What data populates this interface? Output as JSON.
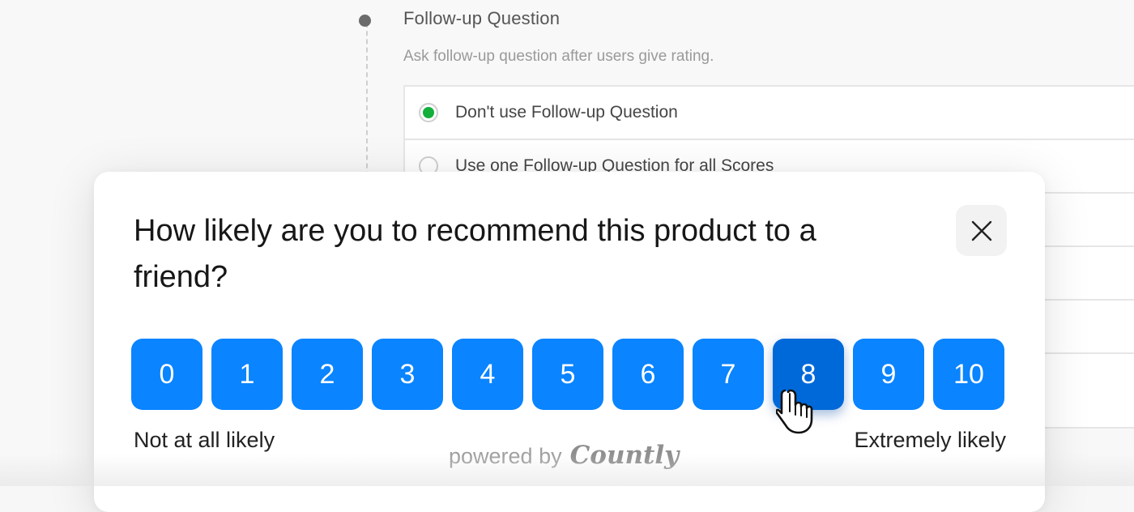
{
  "settings": {
    "section_title": "Follow-up Question",
    "section_description": "Ask follow-up question after users give rating.",
    "options": [
      {
        "label": "Don't use Follow-up Question",
        "checked": true
      },
      {
        "label": "Use one Follow-up Question for all Scores",
        "checked": false
      }
    ],
    "accent_color": "#12af3b"
  },
  "survey": {
    "question": "How likely are you to recommend this product to a friend?",
    "scores": [
      "0",
      "1",
      "2",
      "3",
      "4",
      "5",
      "6",
      "7",
      "8",
      "9",
      "10"
    ],
    "selected_score": "8",
    "low_label": "Not at all likely",
    "high_label": "Extremely likely",
    "powered_by_text": "powered by",
    "brand_name": "Countly",
    "close_icon": "close-icon",
    "button_color": "#0a84ff",
    "selected_button_color": "#0069d9"
  }
}
